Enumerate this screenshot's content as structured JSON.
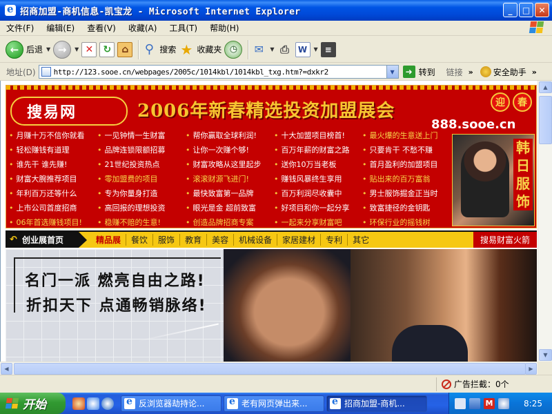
{
  "window": {
    "title": "招商加盟-商机信息-凯宝龙 - Microsoft Internet Explorer",
    "buttons": {
      "minimize": "_",
      "maximize": "□",
      "close": "✕"
    }
  },
  "menu": [
    "文件(F)",
    "编辑(E)",
    "查看(V)",
    "收藏(A)",
    "工具(T)",
    "帮助(H)"
  ],
  "toolbar": {
    "back": "后退",
    "search": "搜索",
    "favorites": "收藏夹"
  },
  "address": {
    "label": "地址(D)",
    "url": "http://123.sooe.cn/webpages/2005c/1014kbl/1014kbl_txg.htm?=dxkr2",
    "go": "转到",
    "links": "链接",
    "assistant": "安全助手"
  },
  "page": {
    "banner": {
      "brand": "搜易网",
      "headline": "2006年新春精选投资加盟展会",
      "domain": "888.sooe.cn",
      "ying": "迎",
      "chun": "春",
      "links": [
        {
          "t": "月赚十万不信你就看",
          "hot": false
        },
        {
          "t": "一见钟情一生财富",
          "hot": false
        },
        {
          "t": "帮你赢取全球利润!",
          "hot": false
        },
        {
          "t": "十大加盟项目榜首!",
          "hot": false
        },
        {
          "t": "最火爆的生意送上门",
          "hot": true
        },
        {
          "t": "轻松赚钱有道理",
          "hot": false
        },
        {
          "t": "品牌连锁限额招募",
          "hot": false
        },
        {
          "t": "让你一次赚个够!",
          "hot": false
        },
        {
          "t": "百万年薪的财富之路",
          "hot": false
        },
        {
          "t": "只要肯干 不愁不赚",
          "hot": false
        },
        {
          "t": "谁先干 谁先赚!",
          "hot": false
        },
        {
          "t": "21世纪投资热点",
          "hot": false
        },
        {
          "t": "财富攻略从这里起步",
          "hot": false
        },
        {
          "t": "送你10万当老板",
          "hot": false
        },
        {
          "t": "首月盈利的加盟项目",
          "hot": false
        },
        {
          "t": "财富大腕推荐项目",
          "hot": false
        },
        {
          "t": "零加盟费的项目",
          "hot": true
        },
        {
          "t": "滚滚财源飞进门!",
          "hot": true
        },
        {
          "t": "赚钱风暴终生享用",
          "hot": false
        },
        {
          "t": "贴出来的百万富翁",
          "hot": true
        },
        {
          "t": "年利百万还等什么",
          "hot": false
        },
        {
          "t": "专为你量身打造",
          "hot": false
        },
        {
          "t": "最快致富第一品牌",
          "hot": false
        },
        {
          "t": "百万利润尽收囊中",
          "hot": false
        },
        {
          "t": "男士服饰掘金正当时",
          "hot": false
        },
        {
          "t": "上市公司首度招商",
          "hot": false
        },
        {
          "t": "高回报的理想投资",
          "hot": false
        },
        {
          "t": "眼光是金 超前致富",
          "hot": false
        },
        {
          "t": "好项目和你一起分享",
          "hot": false
        },
        {
          "t": "致富捷径的金钥匙",
          "hot": false
        },
        {
          "t": "06年首选赚钱项目!",
          "hot": true
        },
        {
          "t": "稳赚不赔的生意!",
          "hot": true
        },
        {
          "t": "创造品牌招商专案",
          "hot": true
        },
        {
          "t": "一起来分享财富吧",
          "hot": true
        },
        {
          "t": "环保行业的摇钱树",
          "hot": true
        }
      ],
      "ad_text": "韩日服饰"
    },
    "nav": {
      "home": "创业展首页",
      "items": [
        "精品展",
        "餐饮",
        "服饰",
        "教育",
        "美容",
        "机械设备",
        "家居建材",
        "专利",
        "其它"
      ],
      "end": "搜易财富火箭"
    },
    "hero": {
      "slogan_line1": "名门一派 燃亮自由之路!",
      "slogan_line2": "折扣天下 点通畅销脉络!"
    }
  },
  "status": {
    "popup_blocker": "广告拦截：0个"
  },
  "taskbar": {
    "start": "开始",
    "tasks": [
      {
        "label": "反浏览器劫持论...",
        "active": false
      },
      {
        "label": "老有网页弹出来...",
        "active": false
      },
      {
        "label": "招商加盟-商机...",
        "active": true
      }
    ],
    "clock": "8:25"
  },
  "colors": {
    "xp_blue": "#0055E5",
    "banner_red": "#C40000",
    "gold": "#F7C531",
    "nav_yellow": "#F6C813"
  }
}
